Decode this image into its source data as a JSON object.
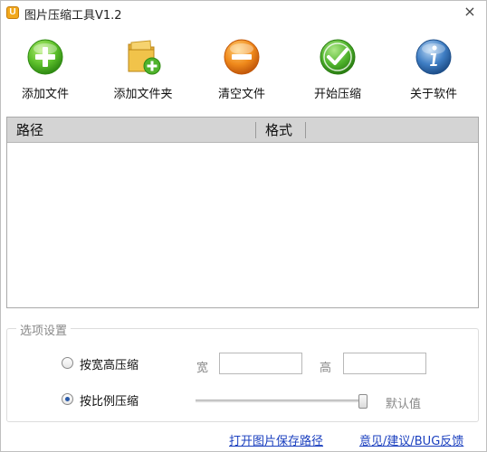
{
  "window": {
    "title": "图片压缩工具V1.2",
    "app_icon_glyph": "U",
    "close_glyph": "×"
  },
  "toolbar": {
    "items": [
      {
        "label": "添加文件",
        "icon": "add-circle-icon",
        "color": "#5cbf2a"
      },
      {
        "label": "添加文件夹",
        "icon": "folder-add-icon",
        "color": "#f1c34a"
      },
      {
        "label": "清空文件",
        "icon": "minus-circle-icon",
        "color": "#f08a1c"
      },
      {
        "label": "开始压缩",
        "icon": "check-circle-icon",
        "color": "#4fb32c"
      },
      {
        "label": "关于软件",
        "icon": "info-circle-icon",
        "color": "#3f7ec4"
      }
    ]
  },
  "file_list": {
    "columns": [
      "路径",
      "格式"
    ],
    "rows": []
  },
  "options": {
    "group_title": "选项设置",
    "mode_wh_label": "按宽高压缩",
    "mode_ratio_label": "按比例压缩",
    "selected_mode": "ratio",
    "width_label": "宽",
    "width_value": "",
    "height_label": "高",
    "height_value": "",
    "ratio_slider_fraction": 1.0,
    "default_label": "默认值"
  },
  "links": {
    "open_save_path": "打开图片保存路径",
    "feedback": "意见/建议/BUG反馈"
  },
  "colors": {
    "accent_link": "#1a3fbf",
    "header_bg": "#d4d4d4"
  }
}
